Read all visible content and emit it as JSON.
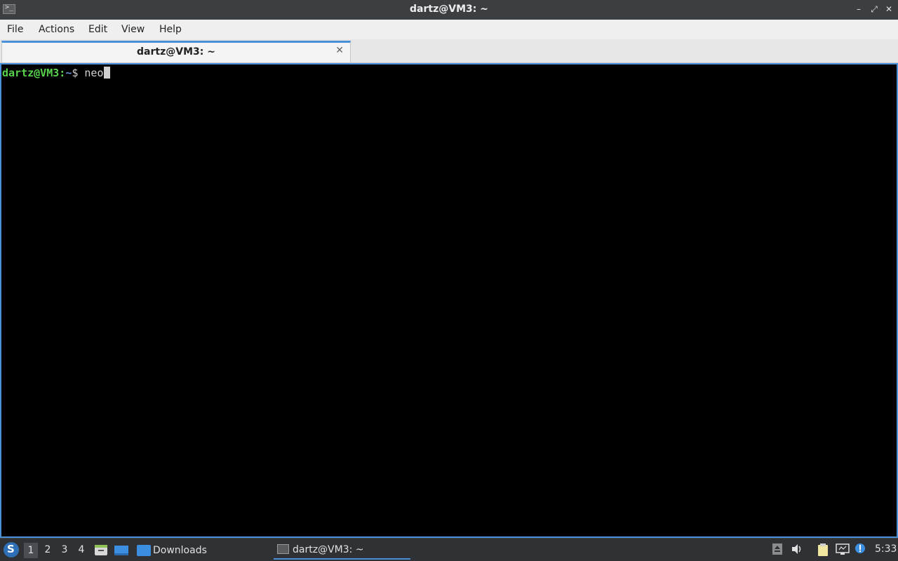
{
  "window": {
    "title": "dartz@VM3: ~",
    "icon": "terminal-icon",
    "controls": {
      "minimize": "–",
      "maximize": "⤢",
      "close": "✕"
    }
  },
  "menubar": {
    "items": [
      "File",
      "Actions",
      "Edit",
      "View",
      "Help"
    ]
  },
  "tabs": [
    {
      "label": "dartz@VM3: ~",
      "close": "✕",
      "active": true
    }
  ],
  "terminal": {
    "prompt_user": "dartz@VM3",
    "prompt_sep": ":",
    "prompt_path": "~",
    "prompt_symbol": "$",
    "command": "neo",
    "colors": {
      "user": "#57d34c",
      "path": "#6a8fd4",
      "text": "#d0d0d0",
      "background": "#000000"
    }
  },
  "taskbar": {
    "start_icon": "lxqt-start-icon",
    "workspaces": [
      "1",
      "2",
      "3",
      "4"
    ],
    "active_workspace": "1",
    "launchers": [
      "file-manager-icon",
      "desktop-icon"
    ],
    "tasks": [
      {
        "label": "Downloads",
        "icon": "folder-icon"
      },
      {
        "label": "dartz@VM3: ~",
        "icon": "terminal-icon",
        "active": true
      }
    ],
    "tray": [
      "eject-icon",
      "volume-icon",
      "clipboard-icon",
      "network-icon",
      "notification-icon"
    ],
    "clock": "5:33"
  },
  "accent": "#4a90d9"
}
